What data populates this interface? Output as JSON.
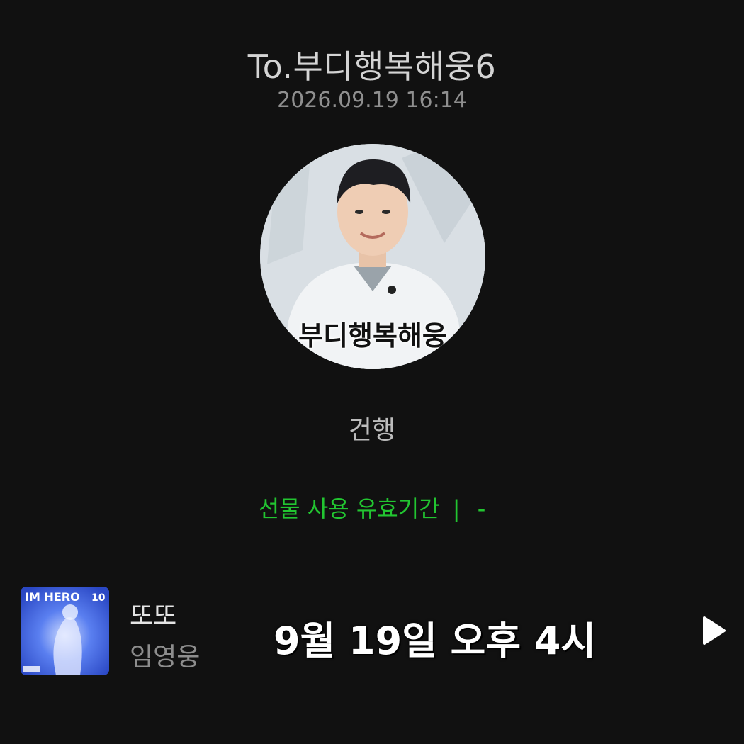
{
  "header": {
    "title": "To.부디행복해웅6",
    "datetime": "2026.09.19 16:14"
  },
  "avatar": {
    "caption": "부디행복해웅"
  },
  "message": {
    "text": "건행"
  },
  "validity": {
    "label": "선물 사용 유효기간",
    "separator": "|",
    "value": "-",
    "color": "#22c531"
  },
  "music": {
    "album_art_text": "IM HERO",
    "title": "또또",
    "artist": "임영웅",
    "overlay": "9월 19일 오후 4시",
    "play_icon": "play-icon"
  },
  "colors": {
    "background": "#111111",
    "accent": "#22c531"
  }
}
